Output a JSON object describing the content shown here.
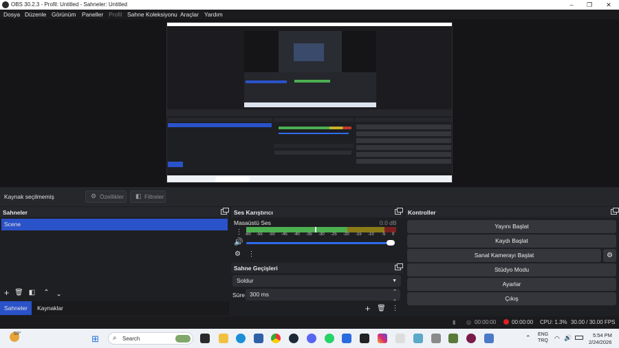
{
  "window": {
    "title": "OBS 30.2.3 - Profil: Untitled - Sahneler: Untitled",
    "controls": {
      "minimize": "–",
      "maximize": "❐",
      "close": "✕"
    }
  },
  "menu": [
    "Dosya",
    "Düzenle",
    "Görünüm",
    "Paneller",
    "Profil",
    "Sahne Koleksiyonu",
    "Araçlar",
    "Yardım"
  ],
  "source_toolbar": {
    "no_source": "Kaynak seçilmemiş",
    "properties": "Özellikler",
    "filters": "Filtreler"
  },
  "scenes_dock": {
    "title": "Sahneler",
    "items": [
      "Scene"
    ],
    "tabs": [
      "Sahneler",
      "Kaynaklar"
    ]
  },
  "mixer_dock": {
    "title": "Ses Karıştırıcı",
    "channel": "Masaüstü Ses",
    "level": "0.0 dB",
    "scale": [
      "-60",
      "-55",
      "-50",
      "-45",
      "-40",
      "-35",
      "-30",
      "-25",
      "-20",
      "-15",
      "-10",
      "-5",
      "0"
    ]
  },
  "transitions_dock": {
    "title": "Sahne Geçişleri",
    "selected": "Soldur",
    "duration_label": "Süre",
    "duration_value": "300 ms"
  },
  "controls_dock": {
    "title": "Kontroller",
    "buttons": [
      "Yayını Başlat",
      "Kaydı Başlat",
      "Sanal Kamerayı Başlat",
      "Stüdyo Modu",
      "Ayarlar",
      "Çıkış"
    ]
  },
  "status": {
    "stream_time": "00:00:00",
    "rec_time": "00:00:00",
    "cpu": "CPU: 1.3%",
    "fps": "30.00 / 30.00 FPS"
  },
  "taskbar": {
    "weather": "59°",
    "search": "Search",
    "lang_top": "ENG",
    "lang_bottom": "TRQ",
    "time": "5:54 PM",
    "date": "2/24/2026"
  },
  "colors": {
    "selection": "#2a52c9",
    "meter_green": "#4caf50",
    "meter_yellow": "#c8b52a",
    "meter_red": "#c0392b",
    "record_dot": "#e02020",
    "slider_blue": "#2f6bf2"
  }
}
